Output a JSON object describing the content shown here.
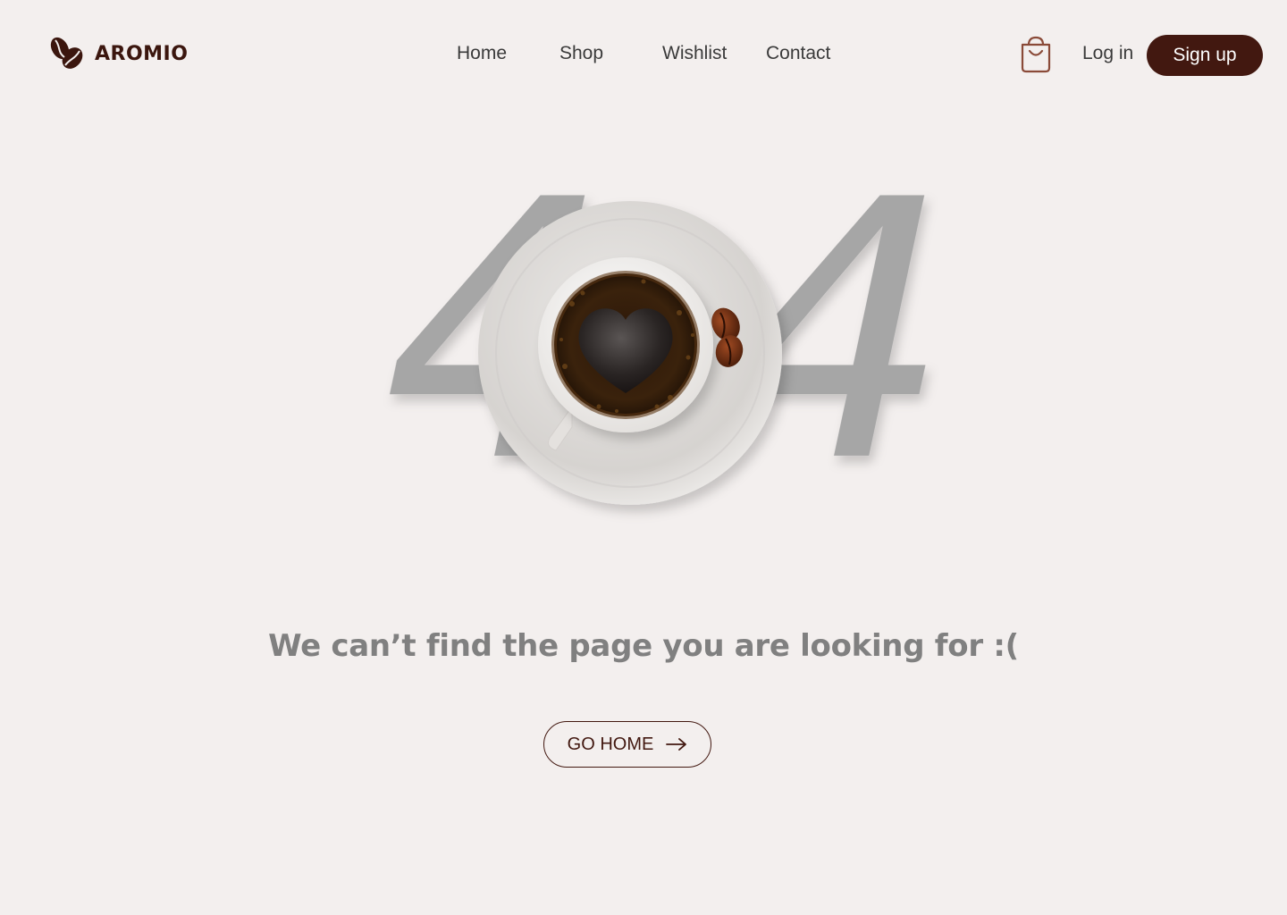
{
  "brand": {
    "name": "AROMIO",
    "icon": "coffee-beans-icon",
    "color": "#3b160e"
  },
  "nav": {
    "items": [
      {
        "label": "Home"
      },
      {
        "label": "Shop"
      },
      {
        "label": "Wishlist"
      },
      {
        "label": "Contact"
      }
    ]
  },
  "header_actions": {
    "cart_icon": "shopping-bag-icon",
    "login_label": "Log in",
    "signup_label": "Sign up"
  },
  "error": {
    "code_left_digit": "4",
    "code_right_digit": "4",
    "code_middle_image": "coffee-cup-with-heart-latte",
    "message": "We can’t find the page you are looking for :(",
    "button_label": "GO HOME",
    "button_icon": "arrow-right-icon"
  },
  "colors": {
    "background": "#f3efee",
    "accent": "#421810",
    "digits": "#a6a6a6",
    "message": "#808080"
  }
}
